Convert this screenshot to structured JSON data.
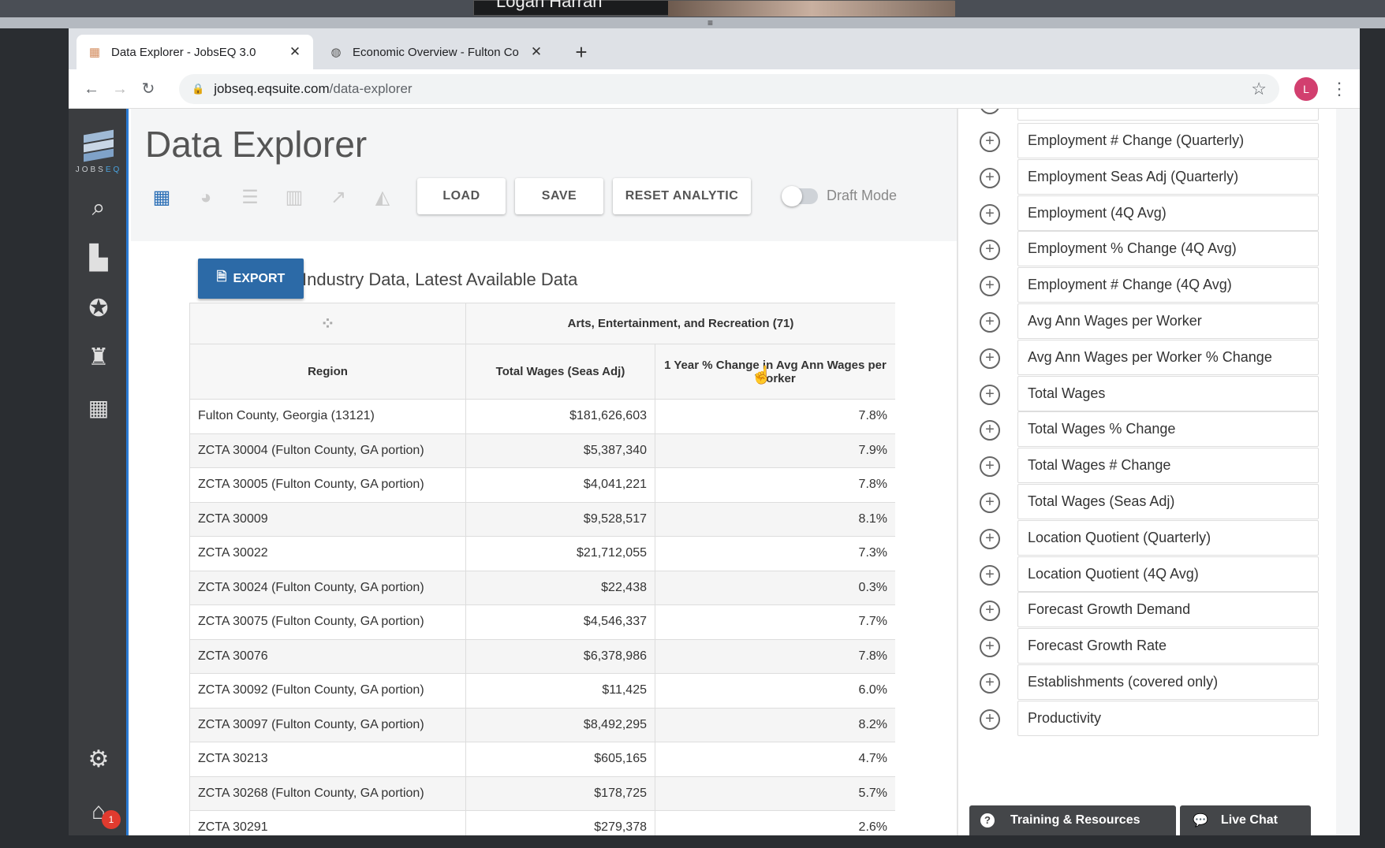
{
  "meeting": {
    "participant_name": "Logan Harran"
  },
  "browser": {
    "tabs": [
      {
        "title": "Data Explorer - JobsEQ 3.0",
        "favicon": "chart-favicon"
      },
      {
        "title": "Economic Overview - Fulton Co",
        "favicon": "globe-favicon"
      }
    ],
    "url_domain": "jobseq.eqsuite.com",
    "url_path": "/data-explorer",
    "profile_initial": "L"
  },
  "sidebar": {
    "logo_text_a": "JOBS",
    "logo_text_b": "EQ",
    "icons": [
      "search-icon",
      "factory-icon",
      "award-icon",
      "worker-icon",
      "grid-icon",
      "gear-icon",
      "home-mail-icon"
    ],
    "notification_count": "1"
  },
  "page": {
    "title": "Data Explorer",
    "buttons": {
      "load": "LOAD",
      "save": "SAVE",
      "reset": "RESET ANALYTIC"
    },
    "draft_mode_label": "Draft Mode",
    "export_label": "EXPORT",
    "table_title": "Industry Data, Latest Available Data"
  },
  "table": {
    "group_header": "Arts, Entertainment, and Recreation (71)",
    "columns": [
      "Region",
      "Total Wages (Seas Adj)",
      "1 Year % Change in Avg Ann Wages per Worker"
    ],
    "rows": [
      [
        "Fulton County, Georgia (13121)",
        "$181,626,603",
        "7.8%"
      ],
      [
        "ZCTA 30004 (Fulton County, GA portion)",
        "$5,387,340",
        "7.9%"
      ],
      [
        "ZCTA 30005 (Fulton County, GA portion)",
        "$4,041,221",
        "7.8%"
      ],
      [
        "ZCTA 30009",
        "$9,528,517",
        "8.1%"
      ],
      [
        "ZCTA 30022",
        "$21,712,055",
        "7.3%"
      ],
      [
        "ZCTA 30024 (Fulton County, GA portion)",
        "$22,438",
        "0.3%"
      ],
      [
        "ZCTA 30075 (Fulton County, GA portion)",
        "$4,546,337",
        "7.7%"
      ],
      [
        "ZCTA 30076",
        "$6,378,986",
        "7.8%"
      ],
      [
        "ZCTA 30092 (Fulton County, GA portion)",
        "$11,425",
        "6.0%"
      ],
      [
        "ZCTA 30097 (Fulton County, GA portion)",
        "$8,492,295",
        "8.2%"
      ],
      [
        "ZCTA 30213",
        "$605,165",
        "4.7%"
      ],
      [
        "ZCTA 30268 (Fulton County, GA portion)",
        "$178,725",
        "5.7%"
      ],
      [
        "ZCTA 30291",
        "$279,378",
        "2.6%"
      ]
    ]
  },
  "fields": [
    "Employment # Change (Quarterly)",
    "Employment Seas Adj (Quarterly)",
    "Employment (4Q Avg)",
    "Employment % Change (4Q Avg)",
    "Employment # Change (4Q Avg)",
    "Avg Ann Wages per Worker",
    "Avg Ann Wages per Worker % Change",
    "Total Wages",
    "Total Wages % Change",
    "Total Wages # Change",
    "Total Wages (Seas Adj)",
    "Location Quotient (Quarterly)",
    "Location Quotient (4Q Avg)",
    "Forecast Growth Demand",
    "Forecast Growth Rate",
    "Establishments (covered only)",
    "Productivity"
  ],
  "help": {
    "training_label": "Training & Resources",
    "chat_label": "Live Chat"
  }
}
